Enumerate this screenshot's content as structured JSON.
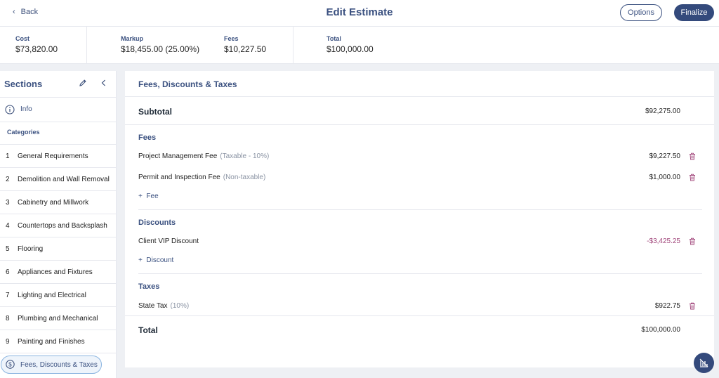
{
  "header": {
    "back_label": "Back",
    "title": "Edit Estimate",
    "options_label": "Options",
    "finalize_label": "Finalize"
  },
  "summary": {
    "cost_label": "Cost",
    "cost_value": "$73,820.00",
    "markup_label": "Markup",
    "markup_value": "$18,455.00 (25.00%)",
    "fees_label": "Fees",
    "fees_value": "$10,227.50",
    "total_label": "Total",
    "total_value": "$100,000.00"
  },
  "sidebar": {
    "title": "Sections",
    "info_label": "Info",
    "categories_label": "Categories",
    "items": [
      {
        "num": "1",
        "label": "General Requirements"
      },
      {
        "num": "2",
        "label": "Demolition and Wall Removal"
      },
      {
        "num": "3",
        "label": "Cabinetry and Millwork"
      },
      {
        "num": "4",
        "label": "Countertops and Backsplash"
      },
      {
        "num": "5",
        "label": "Flooring"
      },
      {
        "num": "6",
        "label": "Appliances and Fixtures"
      },
      {
        "num": "7",
        "label": "Lighting and Electrical"
      },
      {
        "num": "8",
        "label": "Plumbing and Mechanical"
      },
      {
        "num": "9",
        "label": "Painting and Finishes"
      }
    ],
    "active_label": "Fees, Discounts & Taxes"
  },
  "main": {
    "heading": "Fees, Discounts & Taxes",
    "subtotal_label": "Subtotal",
    "subtotal_value": "$92,275.00",
    "fees_title": "Fees",
    "fees": [
      {
        "label": "Project Management Fee",
        "note": "(Taxable - 10%)",
        "amount": "$9,227.50"
      },
      {
        "label": "Permit and Inspection Fee",
        "note": "(Non-taxable)",
        "amount": "$1,000.00"
      }
    ],
    "add_fee_label": "Fee",
    "discounts_title": "Discounts",
    "discounts": [
      {
        "label": "Client VIP Discount",
        "amount": "-$3,425.25"
      }
    ],
    "add_discount_label": "Discount",
    "taxes_title": "Taxes",
    "taxes": [
      {
        "label": "State Tax",
        "note": "(10%)",
        "amount": "$922.75"
      }
    ],
    "total_label": "Total",
    "total_value": "$100,000.00"
  },
  "colors": {
    "brand": "#344a7c",
    "negative": "#a0457a",
    "trash": "#a0457a"
  }
}
